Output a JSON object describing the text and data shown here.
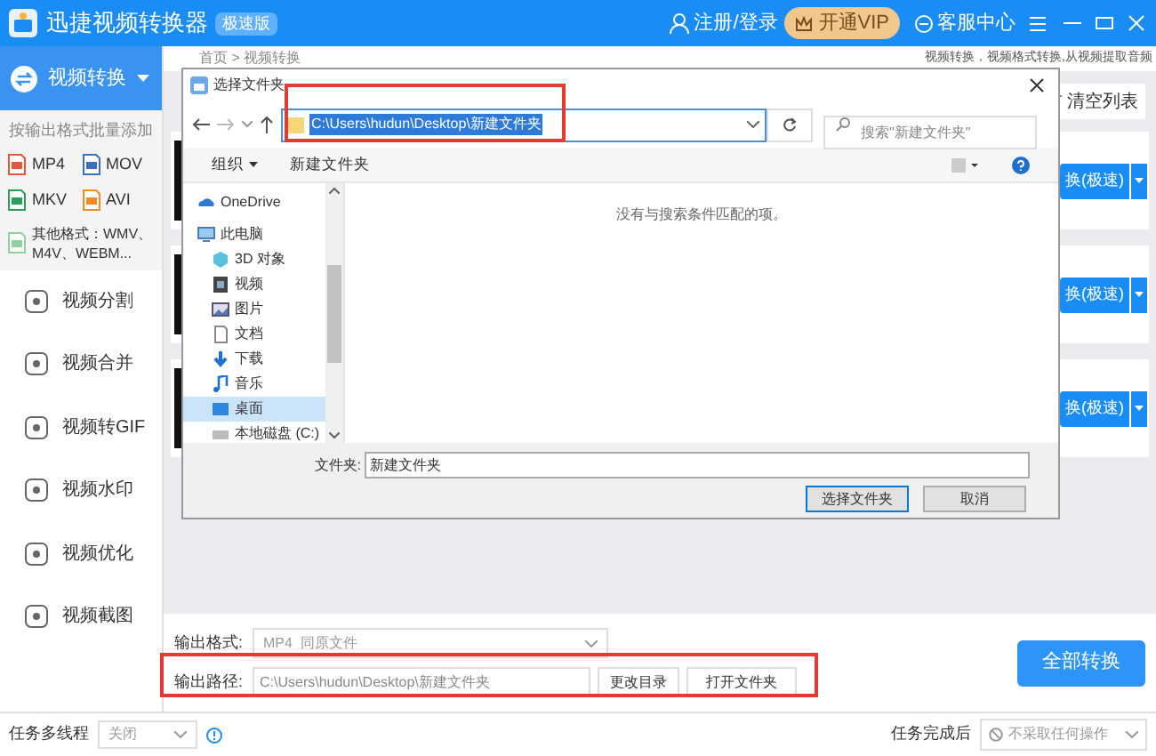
{
  "app": {
    "title": "迅捷视频转换器",
    "badge": "极速版"
  },
  "header": {
    "login": "注册/登录",
    "vip": "开通VIP",
    "support": "客服中心"
  },
  "sidebar": {
    "current": "视频转换",
    "hint": "按输出格式批量添加",
    "formats": [
      {
        "label": "MP4",
        "color": "#e8553d"
      },
      {
        "label": "MOV",
        "color": "#3b6fc4"
      },
      {
        "label": "MKV",
        "color": "#2e9e5b"
      },
      {
        "label": "AVI",
        "color": "#f08a24"
      },
      {
        "label": "其他格式：WMV、M4V、WEBM...",
        "color": "#8fd19e"
      }
    ],
    "tools": [
      {
        "label": "视频分割"
      },
      {
        "label": "视频合并"
      },
      {
        "label": "视频转GIF"
      },
      {
        "label": "视频水印"
      },
      {
        "label": "视频优化"
      },
      {
        "label": "视频截图"
      }
    ]
  },
  "breadcrumb": "首页 > 视频转换",
  "banner": "视频转换，视频格式转换,从视频提取音频",
  "clear_list": "清空列表",
  "cards": [
    {
      "button": "换(极速)"
    },
    {
      "button": "换(极速)"
    },
    {
      "button": "换(极速)"
    }
  ],
  "dialog": {
    "title": "选择文件夹",
    "address": "C:\\Users\\hudun\\Desktop\\新建文件夹",
    "search": {
      "placeholder": "搜索\"新建文件夹\""
    },
    "organize": "组织",
    "new_folder": "新建文件夹",
    "empty_message": "没有与搜索条件匹配的项。",
    "nav": [
      {
        "label": "OneDrive",
        "kind": "cloud",
        "selected": false
      },
      {
        "label": "此电脑",
        "kind": "computer",
        "selected": false,
        "children": [
          {
            "label": "3D 对象",
            "kind": "cube",
            "selected": false
          },
          {
            "label": "视频",
            "kind": "video",
            "selected": false
          },
          {
            "label": "图片",
            "kind": "picture",
            "selected": false
          },
          {
            "label": "文档",
            "kind": "document",
            "selected": false
          },
          {
            "label": "下载",
            "kind": "download",
            "selected": false
          },
          {
            "label": "音乐",
            "kind": "music",
            "selected": false
          },
          {
            "label": "桌面",
            "kind": "desktop",
            "selected": true
          },
          {
            "label": "本地磁盘 (C:)",
            "kind": "drive",
            "selected": false
          }
        ]
      }
    ],
    "folder_label": "文件夹:",
    "folder_value": "新建文件夹",
    "buttons": [
      {
        "label": "选择文件夹",
        "selected": true
      },
      {
        "label": "取消",
        "selected": false
      }
    ]
  },
  "output": {
    "format_label": "输出格式:",
    "format_value": "MP4  同原文件",
    "path_label": "输出路径:",
    "path_value": "C:\\Users\\hudun\\Desktop\\新建文件夹",
    "change_dir": "更改目录",
    "open_folder": "打开文件夹",
    "convert_all": "全部转换"
  },
  "status_bar": {
    "threads_label": "任务多线程",
    "threads_value": "关闭",
    "after_label": "任务完成后",
    "after_value": "不采取任何操作"
  }
}
